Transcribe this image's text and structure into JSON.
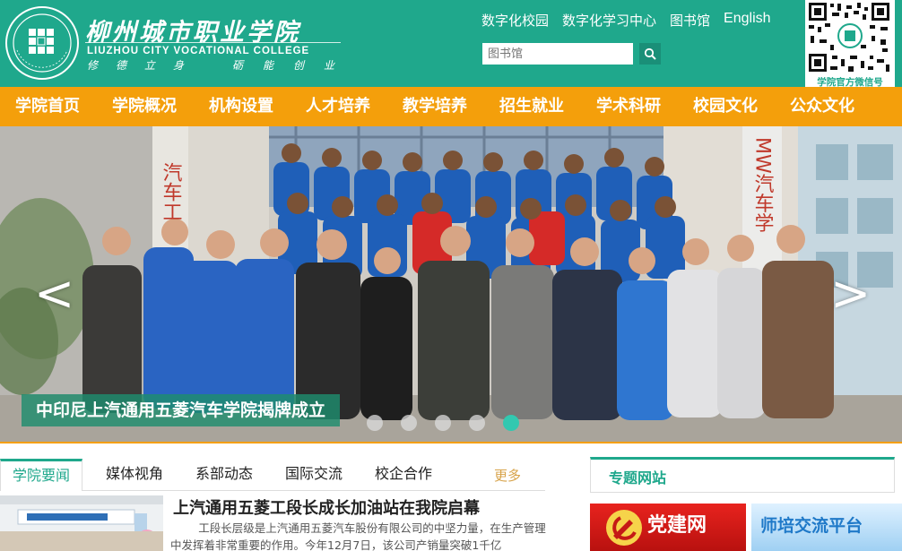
{
  "header": {
    "logo_cn": "柳州城市职业学院",
    "logo_en": "LIUZHOU CITY VOCATIONAL COLLEGE",
    "motto": [
      "修",
      "德",
      "立",
      "身",
      "砺",
      "能",
      "创",
      "业"
    ],
    "top_links": [
      "数字化校园",
      "数字化学习中心",
      "图书馆",
      "English"
    ],
    "search_placeholder": "图书馆",
    "qr_caption": "学院官方微信号"
  },
  "nav": {
    "items": [
      "学院首页",
      "学院概况",
      "机构设置",
      "人才培养",
      "教学培养",
      "招生就业",
      "学术科研",
      "校园文化",
      "公众文化"
    ]
  },
  "hero": {
    "caption": "中印尼上汽通用五菱汽车学院揭牌成立",
    "prev_arrow": "<",
    "next_arrow": ">",
    "slide_count": 5,
    "active_slide": 5,
    "sign_left": "汽车工",
    "sign_right": "MW汽车学"
  },
  "news": {
    "tabs": [
      "学院要闻",
      "媒体视角",
      "系部动态",
      "国际交流",
      "校企合作"
    ],
    "active_tab": "学院要闻",
    "more": "更多",
    "headline": "上汽通用五菱工段长成长加油站在我院启幕",
    "summary": "工段长层级是上汽通用五菱汽车股份有限公司的中坚力量，在生产管理中发挥着非常重要的作用。今年12月7日，该公司产销量突破1千亿"
  },
  "special": {
    "title": "专题网站",
    "banner1": "党建网",
    "banner2": "师培交流平台"
  },
  "colors": {
    "header_green": "#1fa88c",
    "nav_orange": "#f49f0b",
    "accent_teal": "#32c8b0",
    "caption_bg": "#1f8c6e"
  }
}
